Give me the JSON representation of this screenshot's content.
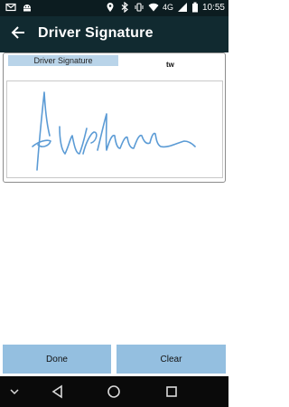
{
  "status_bar": {
    "network": "4G",
    "time": "10:55",
    "icons": [
      "mail-icon",
      "android-icon",
      "location-icon",
      "bluetooth-icon",
      "vibrate-icon",
      "wifi-icon",
      "signal-icon",
      "battery-icon"
    ]
  },
  "app_bar": {
    "title": "Driver Signature",
    "back_icon": "arrow-back-icon"
  },
  "signature": {
    "label": "Driver Signature",
    "initials": "tw",
    "stroke_color": "#5b9bd5"
  },
  "buttons": {
    "done": "Done",
    "clear": "Clear"
  },
  "nav_bar": {
    "icons": [
      "chevron-down-icon",
      "back-triangle-icon",
      "home-circle-icon",
      "recents-square-icon"
    ]
  },
  "colors": {
    "status_bar": "#0c1c20",
    "app_bar": "#112a30",
    "button": "#94bfe0",
    "label_highlight": "#b9d4e9"
  }
}
